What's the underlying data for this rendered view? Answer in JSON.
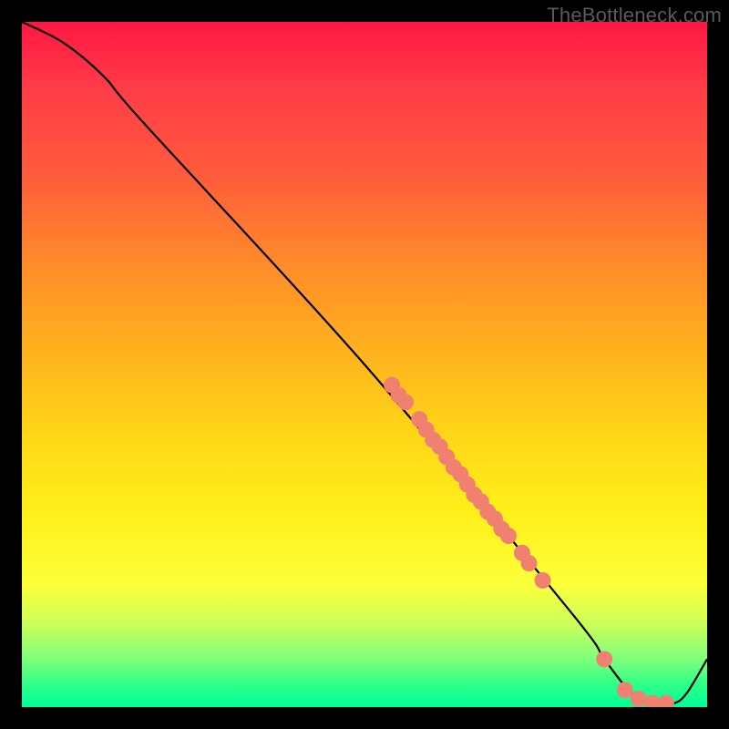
{
  "watermark": "TheBottleneck.com",
  "chart_data": {
    "type": "line",
    "title": "",
    "xlabel": "",
    "ylabel": "",
    "xlim": [
      0,
      100
    ],
    "ylim": [
      0,
      100
    ],
    "curve": [
      {
        "x": 0,
        "y": 100
      },
      {
        "x": 6,
        "y": 97
      },
      {
        "x": 12,
        "y": 92
      },
      {
        "x": 18,
        "y": 85
      },
      {
        "x": 50,
        "y": 50
      },
      {
        "x": 80,
        "y": 14
      },
      {
        "x": 85,
        "y": 7
      },
      {
        "x": 89,
        "y": 2
      },
      {
        "x": 92,
        "y": 0.5
      },
      {
        "x": 95,
        "y": 0.5
      },
      {
        "x": 97,
        "y": 2
      },
      {
        "x": 100,
        "y": 7
      }
    ],
    "markers": [
      {
        "x": 54,
        "y": 47
      },
      {
        "x": 55,
        "y": 45.5
      },
      {
        "x": 56,
        "y": 44.5
      },
      {
        "x": 58,
        "y": 42
      },
      {
        "x": 59,
        "y": 40.5
      },
      {
        "x": 60,
        "y": 39
      },
      {
        "x": 61,
        "y": 38
      },
      {
        "x": 62,
        "y": 36.5
      },
      {
        "x": 63,
        "y": 35
      },
      {
        "x": 64,
        "y": 34
      },
      {
        "x": 65,
        "y": 32.5
      },
      {
        "x": 66,
        "y": 31
      },
      {
        "x": 67,
        "y": 30
      },
      {
        "x": 68,
        "y": 28.5
      },
      {
        "x": 69,
        "y": 27.5
      },
      {
        "x": 70,
        "y": 26
      },
      {
        "x": 71,
        "y": 25
      },
      {
        "x": 73,
        "y": 22.5
      },
      {
        "x": 74,
        "y": 21
      },
      {
        "x": 76,
        "y": 18.5
      },
      {
        "x": 85,
        "y": 7
      },
      {
        "x": 88,
        "y": 2.5
      },
      {
        "x": 90,
        "y": 1.2
      },
      {
        "x": 92,
        "y": 0.6
      },
      {
        "x": 94,
        "y": 0.6
      }
    ],
    "marker_color": "#f08070",
    "marker_radius_px": 9,
    "colors": {
      "top": "#ff1744",
      "mid": "#ffe018",
      "bottom": "#00ff99"
    }
  }
}
